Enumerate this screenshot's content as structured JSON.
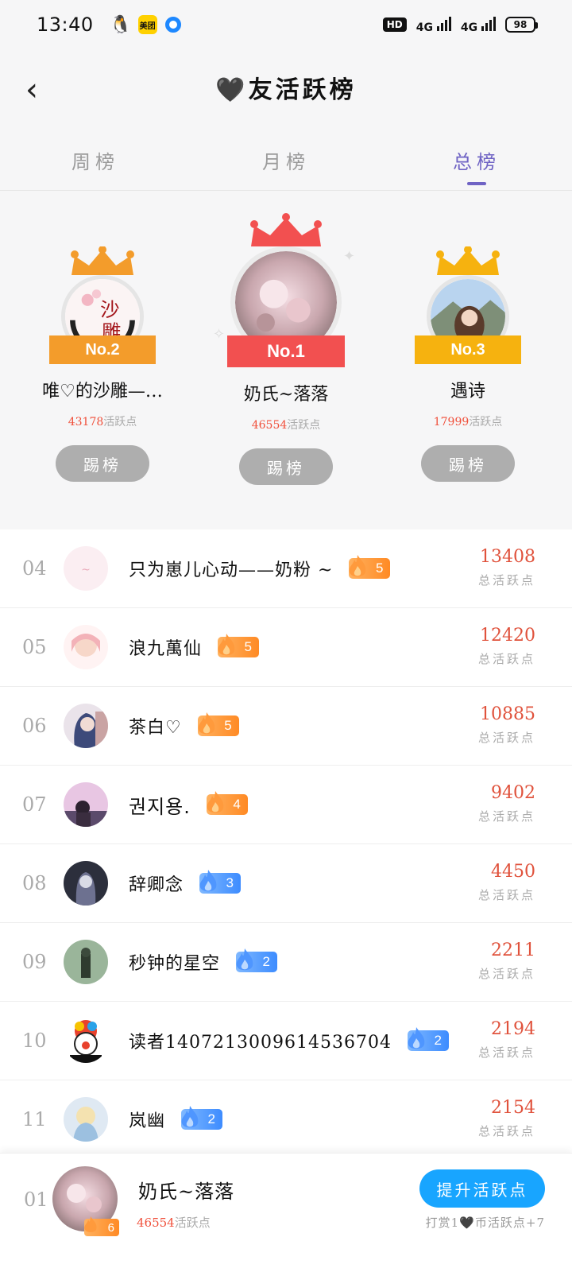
{
  "status": {
    "time": "13:40",
    "meituan_label": "美团",
    "hd_label": "HD",
    "net1": "4G",
    "net2": "4G",
    "battery": "98"
  },
  "header": {
    "back_icon": "chevron-left-icon",
    "title": "🖤友活跃榜"
  },
  "tabs": [
    {
      "label": "周榜",
      "active": false
    },
    {
      "label": "月榜",
      "active": false
    },
    {
      "label": "总榜",
      "active": true
    }
  ],
  "podium": {
    "points_suffix": "活跃点",
    "button_label": "踢榜",
    "first": {
      "badge": "No.1",
      "name": "奶氏~落落",
      "points": "46554"
    },
    "second": {
      "badge": "No.2",
      "name": "唯♡的沙雕—…",
      "points": "43178",
      "avatar_text_top": "沙",
      "avatar_text_bottom": "雕"
    },
    "third": {
      "badge": "No.3",
      "name": "遇诗",
      "points": "17999"
    }
  },
  "list": {
    "score_label": "总活跃点",
    "rows": [
      {
        "rank": "04",
        "name": "只为崽儿心动——奶粉 ~",
        "level": "5",
        "badge_color": "orange",
        "score": "13408"
      },
      {
        "rank": "05",
        "name": "浪九萬仙",
        "level": "5",
        "badge_color": "orange",
        "score": "12420"
      },
      {
        "rank": "06",
        "name": "茶白♡",
        "level": "5",
        "badge_color": "orange",
        "score": "10885"
      },
      {
        "rank": "07",
        "name": "권지용.",
        "level": "4",
        "badge_color": "orange",
        "score": "9402"
      },
      {
        "rank": "08",
        "name": "辞卿念",
        "level": "3",
        "badge_color": "blue",
        "score": "4450"
      },
      {
        "rank": "09",
        "name": "秒钟的星空",
        "level": "2",
        "badge_color": "blue",
        "score": "2211"
      },
      {
        "rank": "10",
        "name": "读者14072130096145367​04",
        "level": "2",
        "badge_color": "blue",
        "score": "2194"
      },
      {
        "rank": "11",
        "name": "岚幽",
        "level": "2",
        "badge_color": "blue",
        "score": "2154"
      }
    ]
  },
  "bottom": {
    "rank": "01",
    "name": "奶氏~落落",
    "points": "46554",
    "points_suffix": "活跃点",
    "level": "6",
    "cta_label": "提升活跃点",
    "note": "打赏1🖤币活跃点+7"
  },
  "colors": {
    "accent": "#6f63c4",
    "score_red": "#e0523c",
    "cta_blue": "#18a5ff",
    "badge_orange": "#ff8a24",
    "badge_blue": "#3d8cff"
  }
}
